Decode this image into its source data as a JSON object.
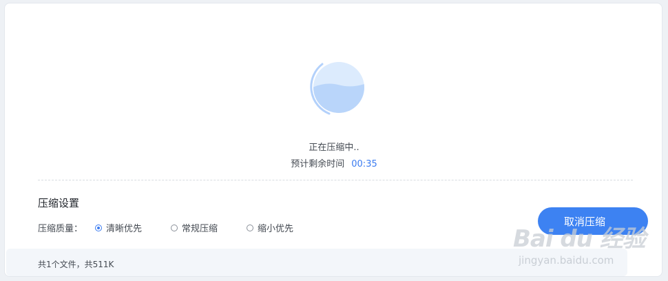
{
  "status": {
    "compressing": "正在压缩中..",
    "remaining_label": "预计剩余时间",
    "remaining_time": "00:35",
    "progress_fraction": 0.55
  },
  "settings": {
    "title": "压缩设置",
    "quality_label": "压缩质量：",
    "options": [
      {
        "label": "清晰优先",
        "checked": true
      },
      {
        "label": "常规压缩",
        "checked": false
      },
      {
        "label": "缩小优先",
        "checked": false
      }
    ]
  },
  "footer": {
    "summary": "共1个文件，共511K"
  },
  "actions": {
    "cancel_label": "取消压缩"
  },
  "watermark": {
    "logo": "Bai du 经验",
    "url": "jingyan.baidu.com"
  },
  "colors": {
    "accent": "#3d82f2",
    "time": "#3a7bf0",
    "water": "#b9d5fa",
    "sphere": "#dcebfd"
  }
}
